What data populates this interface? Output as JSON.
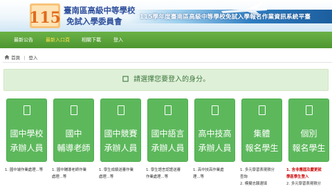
{
  "header": {
    "logo_mark": "115",
    "org_line1": "臺南區高級中等學校",
    "org_line2": "免試入學委員會",
    "system_title": "115學年度臺南區高級中等學校免試入學報名作業資訊系統平臺"
  },
  "nav": {
    "items": [
      "最新公告",
      "最新入口頁",
      "相關下載",
      "登入"
    ],
    "active_index": 1
  },
  "breadcrumb": {
    "home": "首頁",
    "current": "登入"
  },
  "prompt": {
    "text": "請選擇您要登入的身分。"
  },
  "cards": [
    {
      "line1": "國中學校",
      "line2": "承辦人員",
      "desc": [
        "1. 國中端作業處理...等"
      ],
      "desc_red": false
    },
    {
      "line1": "國中",
      "line2": "輔導老師",
      "desc": [
        "1. 國中輔導老師作業",
        "處理...等"
      ],
      "desc_red": false
    },
    {
      "line1": "國中競賽",
      "line2": "承辦人員",
      "desc": [
        "1. 學生成績送審作業",
        "處理...等"
      ],
      "desc_red": false
    },
    {
      "line1": "國中語言",
      "line2": "承辦人員",
      "desc": [
        "1. 學生語言認證送審",
        "作業處理...等"
      ],
      "desc_red": false
    },
    {
      "line1": "高中技高",
      "line2": "承辦人員",
      "desc": [
        "1. 高中技高作業處",
        "理...等"
      ],
      "desc_red": false
    },
    {
      "line1": "集體",
      "line2": "報名學生",
      "desc": [
        "1. 多元學習表現積分",
        "查詢",
        "2. 模擬志願選填"
      ],
      "desc_red": false
    },
    {
      "line1": "個別",
      "line2": "報名學生",
      "desc": [
        "1. 含非應屆及慶更就",
        "學區學生登入",
        "2. 多元學習表現積分"
      ],
      "desc_red": true
    }
  ],
  "colors": {
    "nav_green": "#5aa63a",
    "card_green": "#5db85c",
    "prompt_bg": "#dff0d8",
    "prompt_text": "#3c763d",
    "title_blue": "#2e4f9c",
    "active_nav": "#ffe14a",
    "warning_red": "#cc0000"
  },
  "icons": {
    "home": "home-icon",
    "prompt": "info-icon",
    "card": "user-icon",
    "plane": "airplane-icon",
    "logo": "logo-mark"
  }
}
